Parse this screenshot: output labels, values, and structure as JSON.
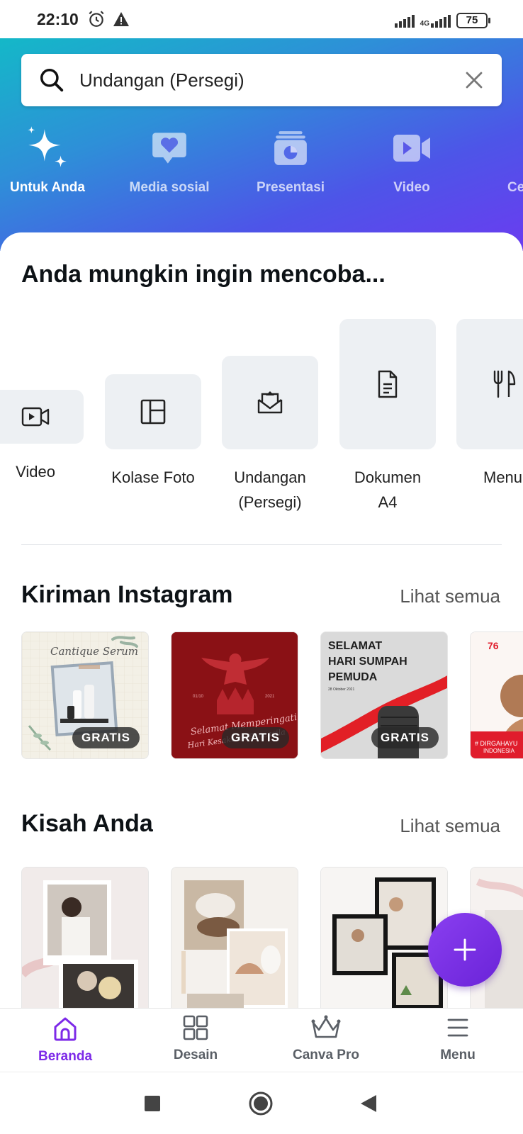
{
  "status": {
    "time": "22:10",
    "network": "4G",
    "battery": "75"
  },
  "search": {
    "value": "Undangan (Persegi)"
  },
  "categories": [
    {
      "label": "Untuk Anda",
      "icon": "sparkle-icon",
      "active": true
    },
    {
      "label": "Media sosial",
      "icon": "heart-chat-icon"
    },
    {
      "label": "Presentasi",
      "icon": "presentation-chart-icon"
    },
    {
      "label": "Video",
      "icon": "video-camera-icon"
    },
    {
      "label": "Ce",
      "icon": "partial-category-icon"
    }
  ],
  "try_section": {
    "title": "Anda mungkin ingin mencoba...",
    "items": [
      {
        "label": "Video",
        "icon": "video-icon"
      },
      {
        "label": "Kolase Foto",
        "icon": "collage-icon"
      },
      {
        "label": "Undangan",
        "label2": "(Persegi)",
        "icon": "envelope-icon"
      },
      {
        "label": "Dokumen",
        "label2": "A4",
        "icon": "document-icon"
      },
      {
        "label": "Menu",
        "icon": "fork-knife-icon"
      }
    ]
  },
  "instagram": {
    "title": "Kiriman Instagram",
    "see_all": "Lihat semua",
    "posts": [
      {
        "badge": "GRATIS",
        "text": "Cantique Serum"
      },
      {
        "badge": "GRATIS",
        "text1": "Selamat Memperingati",
        "text2": "Hari Kesaktian Pancasila",
        "date_left": "01/10",
        "date_right": "2021"
      },
      {
        "badge": "GRATIS",
        "text1": "SELAMAT",
        "text2": "HARI SUMPAH",
        "text3": "PEMUDA",
        "date": "28 Oktober 2021"
      },
      {
        "text1": "76",
        "text2": "# DIRGAHAYU",
        "text3": "INDONESIA"
      }
    ]
  },
  "stories": {
    "title": "Kisah Anda",
    "see_all": "Lihat semua"
  },
  "bottom_nav": [
    {
      "label": "Beranda",
      "icon": "home-icon",
      "active": true
    },
    {
      "label": "Desain",
      "icon": "grid-icon"
    },
    {
      "label": "Canva Pro",
      "icon": "crown-icon"
    },
    {
      "label": "Menu",
      "icon": "hamburger-icon"
    }
  ],
  "colors": {
    "accent": "#7d2ae8",
    "fab": "#7a33e8",
    "header_start": "#14b8c8",
    "header_end": "#6a3cf0"
  }
}
